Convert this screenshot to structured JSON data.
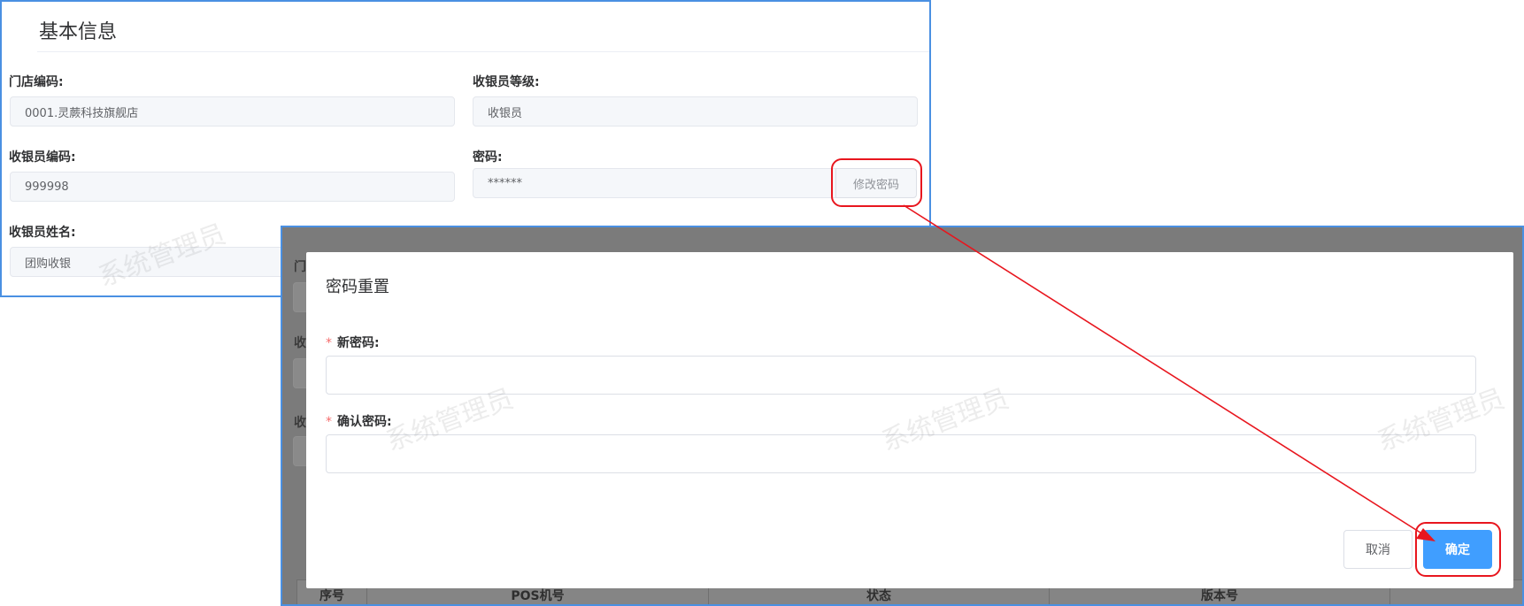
{
  "basic_info": {
    "title": "基本信息",
    "fields": {
      "store_code": {
        "label": "门店编码:",
        "value": "0001.灵蕨科技旗舰店"
      },
      "cashier_level": {
        "label": "收银员等级:",
        "value": "收银员"
      },
      "cashier_code": {
        "label": "收银员编码:",
        "value": "999998"
      },
      "password": {
        "label": "密码:",
        "value": "******"
      },
      "cashier_name": {
        "label": "收银员姓名:",
        "value": "团购收银"
      }
    },
    "modify_password_button": "修改密码"
  },
  "watermark_text": "系统管理员",
  "background_peek": {
    "labels": [
      "门",
      "收",
      "收"
    ],
    "table_headers": [
      "序号",
      "POS机号",
      "状态",
      "版本号"
    ]
  },
  "password_reset_dialog": {
    "title": "密码重置",
    "required_mark": "*",
    "new_password": {
      "label": "新密码:",
      "value": ""
    },
    "confirm_password": {
      "label": "确认密码:",
      "value": ""
    },
    "cancel_button": "取消",
    "confirm_button": "确定"
  },
  "colors": {
    "annotation_red": "#e8161e",
    "primary_blue": "#409eff",
    "frame_blue": "#4a90e2",
    "required_star": "#f56c6c"
  }
}
